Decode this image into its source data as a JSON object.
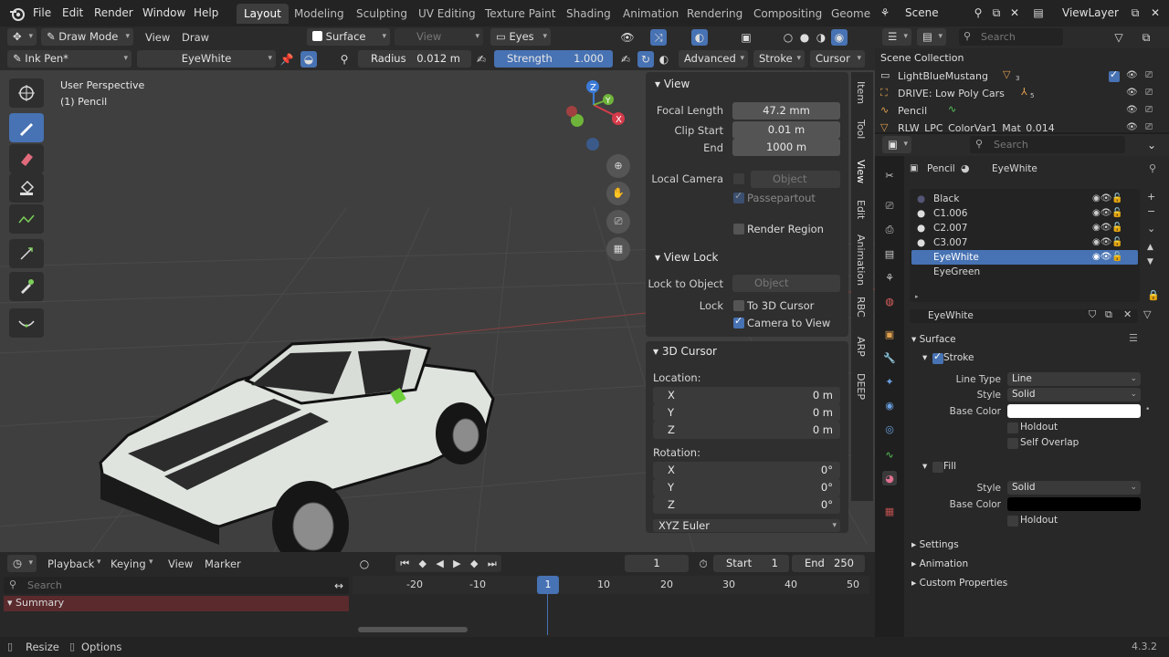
{
  "menubar": {
    "items": [
      "File",
      "Edit",
      "Render",
      "Window",
      "Help"
    ],
    "workspaces": [
      "Layout",
      "Modeling",
      "Sculpting",
      "UV Editing",
      "Texture Paint",
      "Shading",
      "Animation",
      "Rendering",
      "Compositing",
      "Geome"
    ],
    "scene": "Scene",
    "view_layer": "ViewLayer"
  },
  "header1": {
    "mode": "Draw Mode",
    "view": "View",
    "draw": "Draw",
    "surface": "Surface",
    "view_dd": "View",
    "layer": "Eyes"
  },
  "header2": {
    "brush": "Ink Pen*",
    "material": "EyeWhite",
    "radius_label": "Radius",
    "radius_value": "0.012 m",
    "strength_label": "Strength",
    "strength_value": "1.000",
    "advanced": "Advanced",
    "stroke": "Stroke",
    "cursor": "Cursor"
  },
  "viewport": {
    "perspective": "User Perspective",
    "object": "(1) Pencil"
  },
  "npanel": {
    "view_title": "View",
    "focal_length_label": "Focal Length",
    "focal_length": "47.2 mm",
    "clip_start_label": "Clip Start",
    "clip_start": "0.01 m",
    "end_label": "End",
    "end": "1000 m",
    "local_camera_label": "Local Camera",
    "object_placeholder": "Object",
    "passepartout": "Passepartout",
    "render_region": "Render Region",
    "view_lock_title": "View Lock",
    "lock_to_object_label": "Lock to Object",
    "lock_label": "Lock",
    "to_3d_cursor": "To 3D Cursor",
    "camera_to_view": "Camera to View",
    "cursor_title": "3D Cursor",
    "location_label": "Location:",
    "x_label": "X",
    "y_label": "Y",
    "z_label": "Z",
    "loc_x": "0 m",
    "loc_y": "0 m",
    "loc_z": "0 m",
    "rotation_label": "Rotation:",
    "rot_x": "0°",
    "rot_y": "0°",
    "rot_z": "0°",
    "euler": "XYZ Euler"
  },
  "vtabs": [
    "Item",
    "Tool",
    "View",
    "Edit",
    "Animation",
    "RBC",
    "ARP",
    "DEEP"
  ],
  "timeline": {
    "playback": "Playback",
    "keying": "Keying",
    "view": "View",
    "marker": "Marker",
    "current_frame": "1",
    "start_label": "Start",
    "start": "1",
    "end_label": "End",
    "end": "250",
    "search_placeholder": "Search",
    "summary": "Summary",
    "ruler": [
      "-20",
      "-10",
      "1",
      "10",
      "20",
      "30",
      "40",
      "50"
    ]
  },
  "status": {
    "resize": "Resize",
    "options": "Options",
    "version": "4.3.2"
  },
  "outliner": {
    "search_placeholder": "Search",
    "collection": "Scene Collection",
    "items": [
      "LightBlueMustang",
      "DRIVE: Low Poly Cars",
      "Pencil",
      "RLW_LPC_ColorVar1_Mat_0.014"
    ],
    "counts": [
      "3",
      "5"
    ]
  },
  "properties": {
    "search_placeholder": "Search",
    "breadcrumb_object": "Pencil",
    "breadcrumb_material": "EyeWhite",
    "materials": [
      "Black",
      "C1.006",
      "C2.007",
      "C3.007",
      "EyeWhite",
      "EyeGreen"
    ],
    "material_name": "EyeWhite",
    "surface": "Surface",
    "stroke": "Stroke",
    "line_type_label": "Line Type",
    "line_type": "Line",
    "style_label": "Style",
    "style": "Solid",
    "base_color_label": "Base Color",
    "holdout": "Holdout",
    "self_overlap": "Self Overlap",
    "fill": "Fill",
    "fill_style": "Solid",
    "settings": "Settings",
    "animation": "Animation",
    "custom_properties": "Custom Properties"
  },
  "colors": {
    "accent": "#4772b3",
    "base_color_stroke": "#ffffff",
    "base_color_fill": "#000000"
  }
}
